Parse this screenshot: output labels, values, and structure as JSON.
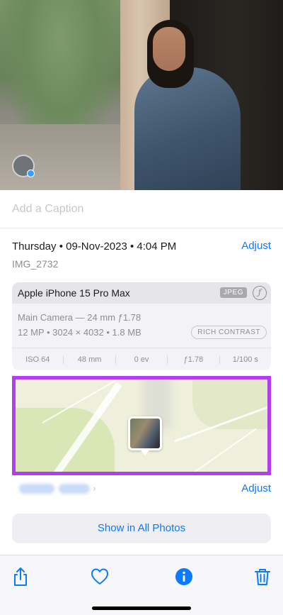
{
  "caption": {
    "placeholder": "Add a Caption"
  },
  "info": {
    "datetime": "Thursday • 09-Nov-2023 • 4:04 PM",
    "adjust_label": "Adjust",
    "filename": "IMG_2732"
  },
  "camera": {
    "model": "Apple iPhone 15 Pro Max",
    "format_badge": "JPEG",
    "aperture_icon": "ƒ",
    "lens": "Main Camera — 24 mm ƒ1.78",
    "specs": "12 MP • 3024 × 4032 • 1.8 MB",
    "style": "RICH CONTRAST",
    "exif": [
      "ISO 64",
      "48 mm",
      "0 ev",
      "ƒ1.78",
      "1/100 s"
    ]
  },
  "map": {
    "location_adjust_label": "Adjust"
  },
  "actions": {
    "show_all_label": "Show in All Photos"
  },
  "toolbar": {
    "icons": [
      "share-icon",
      "heart-icon",
      "info-icon",
      "trash-icon"
    ],
    "accent": "#0a7aff"
  },
  "colors": {
    "accent": "#0a7aff",
    "highlight": "#b23ef0"
  }
}
